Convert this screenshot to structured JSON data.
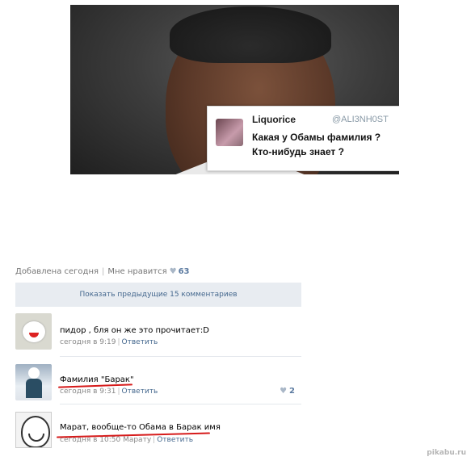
{
  "tweet": {
    "name": "Liquorice",
    "handle": "@ALI3NH0ST",
    "line1": "Какая у Обамы фамилия ?",
    "line2": "Кто-нибудь знает ?"
  },
  "post_meta": {
    "added": "Добавлена сегодня",
    "like_label": "Мне нравится",
    "like_count": "63"
  },
  "show_previous": "Показать предыдущие 15 комментариев",
  "comments": [
    {
      "text": "пидор , бля он же это прочитает:D",
      "time": "сегодня в 9:19",
      "reply": "Ответить",
      "likes": ""
    },
    {
      "text": "Фамилия \"Барак\"",
      "time": "сегодня в 9:31",
      "reply": "Ответить",
      "likes": "2"
    },
    {
      "text": "Марат, вообще-то Обама в Барак имя",
      "time": "сегодня в 10:50 Марату",
      "reply": "Ответить",
      "likes": ""
    }
  ],
  "watermark": "pikabu.ru",
  "colors": {
    "link": "#45688e",
    "underline": "#d61b1b",
    "button_bg": "#e8ecf1"
  }
}
